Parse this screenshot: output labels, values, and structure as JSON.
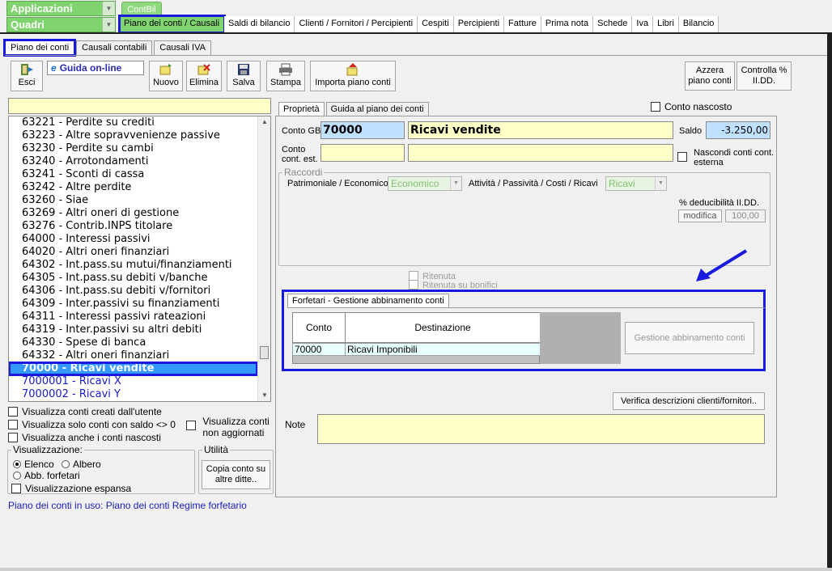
{
  "top": {
    "combo1": "Applicazioni",
    "combo2": "Quadri",
    "app_tab": "ContBil",
    "menu": [
      "Piano dei conti / Causali",
      "Saldi di bilancio",
      "Clienti / Fornitori / Percipienti",
      "Cespiti",
      "Percipienti",
      "Fatture",
      "Prima nota",
      "Schede",
      "Iva",
      "Libri",
      "Bilancio"
    ]
  },
  "subtabs": [
    "Piano dei conti",
    "Causali contabili",
    "Causali IVA"
  ],
  "toolbar": {
    "esci": "Esci",
    "guida": "Guida on-line",
    "nuovo": "Nuovo",
    "elimina": "Elimina",
    "salva": "Salva",
    "stampa": "Stampa",
    "importa": "Importa piano conti",
    "azzera": "Azzera piano conti",
    "controlla": "Controlla % II.DD."
  },
  "list": {
    "items": [
      "63221 - Perdite su crediti",
      "63223 - Altre sopravvenienze passive",
      "63230 - Perdite su cambi",
      "63240 - Arrotondamenti",
      "63241 - Sconti di cassa",
      "63242 - Altre perdite",
      "63260 - Siae",
      "63269 - Altri oneri di gestione",
      "63276 - Contrib.INPS titolare",
      "64000 - Interessi passivi",
      "64020 - Altri oneri finanziari",
      "64302 - Int.pass.su mutui/finanziamenti",
      "64305 - Int.pass.su debiti v/banche",
      "64306 - Int.pass.su debiti v/fornitori",
      "64309 - Inter.passivi su finanziamenti",
      "64311 - Interessi passivi rateazioni",
      "64319 - Inter.passivi su altri debiti",
      "64330 - Spese di banca",
      "64332 - Altri oneri finanziari",
      "70000 - Ricavi vendite",
      "7000001 - Ricavi X",
      "7000002 - Ricavi Y"
    ]
  },
  "options": {
    "chk1": "Visualizza conti creati dall'utente",
    "chk2": "Visualizza solo conti con saldo <> 0",
    "chk3": "Visualizza anche i conti nascosti",
    "chk4a": "Visualizza conti",
    "chk4b": "non aggiornati",
    "vis_title": "Visualizzazione:",
    "radio_elenco": "Elenco",
    "radio_albero": "Albero",
    "radio_abb": "Abb. forfetari",
    "chk_espansa": "Visualizzazione espansa",
    "utilita_title": "Utilità",
    "copia_btn": "Copia conto su altre ditte.."
  },
  "status": "Piano dei conti in uso: Piano dei conti Regime forfetario",
  "right": {
    "tabs": [
      "Proprietà",
      "Guida al piano dei conti"
    ],
    "conto_nascosto": "Conto nascosto",
    "conto_gb_label": "Conto GB",
    "conto_gb_code": "70000",
    "conto_gb_desc": "Ricavi vendite",
    "saldo_label": "Saldo",
    "saldo_value": "-3.250,00",
    "conto_est_label1": "Conto",
    "conto_est_label2": "cont. est.",
    "nascondi1": "Nascondi conti cont.",
    "nascondi2": "esterna",
    "raccordi_title": "Raccordi",
    "patr_label": "Patrimoniale / Economico",
    "patr_value": "Economico",
    "att_label": "Attività / Passività / Costi / Ricavi",
    "att_value": "Ricavi",
    "deduc_label": "% deducibilità II.DD.",
    "modifica": "modifica",
    "deduc_value": "100,00",
    "ritenuta": "Ritenuta",
    "ritenuta_bon": "Ritenuta su bonifici",
    "forf_tab": "Forfetari - Gestione abbinamento conti",
    "grid_head_conto": "Conto",
    "grid_head_dest": "Destinazione",
    "grid_conto": "70000",
    "grid_dest": "Ricavi Imponibili",
    "gestione_btn": "Gestione abbinamento conti",
    "verifica_btn": "Verifica descrizioni clienti/fornitori..",
    "note_label": "Note"
  }
}
